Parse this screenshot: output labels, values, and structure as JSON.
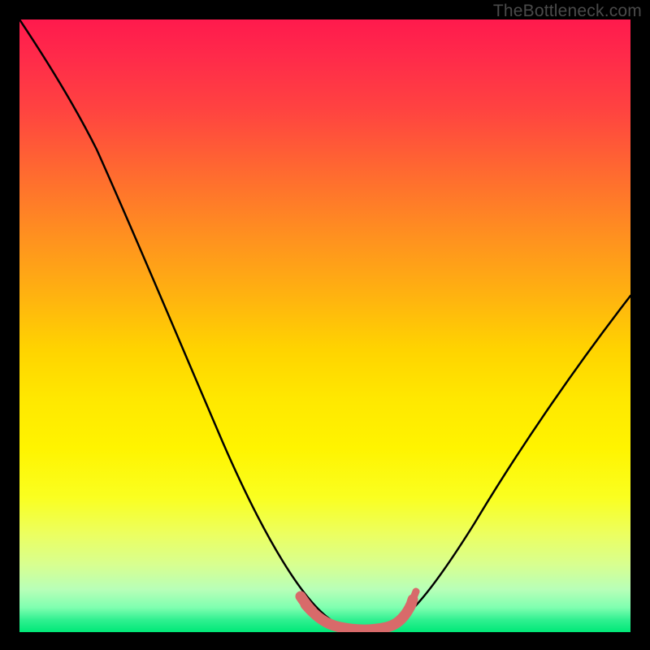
{
  "watermark": "TheBottleneck.com",
  "colors": {
    "frame": "#000000",
    "curve": "#000000",
    "flat_region": "#d86a6a",
    "gradient_top": "#ff1a4d",
    "gradient_bottom": "#00e878"
  },
  "chart_data": {
    "type": "line",
    "title": "",
    "xlabel": "",
    "ylabel": "",
    "xlim": [
      0,
      100
    ],
    "ylim": [
      0,
      100
    ],
    "grid": false,
    "legend": false,
    "annotations": [
      "TheBottleneck.com"
    ],
    "series": [
      {
        "name": "bottleneck-curve",
        "x": [
          0,
          4,
          8,
          12,
          16,
          20,
          24,
          28,
          32,
          36,
          40,
          44,
          48,
          50,
          52,
          55,
          58,
          60,
          64,
          68,
          72,
          76,
          80,
          84,
          88,
          92,
          96,
          100
        ],
        "values": [
          100,
          96,
          91,
          86,
          80,
          73,
          66,
          58,
          50,
          41,
          32,
          22,
          12,
          7,
          3,
          1,
          0.5,
          1,
          3,
          7,
          12,
          18,
          24,
          30,
          36,
          42,
          48,
          54
        ]
      },
      {
        "name": "optimal-flat-region",
        "x": [
          48,
          50,
          52,
          54,
          56,
          58,
          60
        ],
        "values": [
          3,
          1.5,
          1,
          0.8,
          1,
          1.5,
          3
        ]
      }
    ],
    "background_gradient_stops": [
      {
        "pos": 0.0,
        "color": "#ff1a4d"
      },
      {
        "pos": 0.5,
        "color": "#ffd400"
      },
      {
        "pos": 0.9,
        "color": "#d8ff90"
      },
      {
        "pos": 1.0,
        "color": "#00e878"
      }
    ]
  }
}
